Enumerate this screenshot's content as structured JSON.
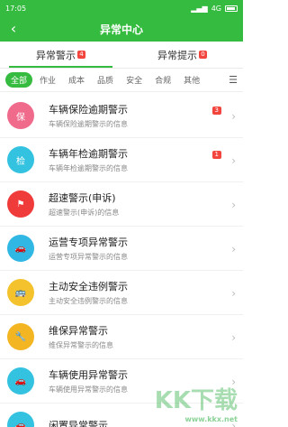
{
  "status": {
    "time": "17:05",
    "battery": "4G"
  },
  "header": {
    "title": "异常中心",
    "back_icon": "chevron-left-icon"
  },
  "tabs": [
    {
      "label": "异常警示",
      "badge": "4",
      "active": true
    },
    {
      "label": "异常提示",
      "badge": "0",
      "active": false
    }
  ],
  "filters": {
    "chips": [
      "全部",
      "作业",
      "成本",
      "品质",
      "安全",
      "合规",
      "其他"
    ],
    "active_index": 0,
    "menu_icon": "list-icon"
  },
  "items": [
    {
      "title": "车辆保险逾期警示",
      "sub": "车辆保险逾期警示的信息",
      "count": "3",
      "color": "#f06a8b",
      "icon": "shield-icon",
      "glyph": "保"
    },
    {
      "title": "车辆年检逾期警示",
      "sub": "车辆年检逾期警示的信息",
      "count": "1",
      "color": "#33c2df",
      "icon": "check-icon",
      "glyph": "检"
    },
    {
      "title": "超速警示(申诉)",
      "sub": "超速警示(申诉)的信息",
      "count": "",
      "color": "#f03b3b",
      "icon": "speed-icon",
      "glyph": "⚑"
    },
    {
      "title": "运营专项异常警示",
      "sub": "运营专项异常警示的信息",
      "count": "",
      "color": "#30b7e3",
      "icon": "car-icon",
      "glyph": "🚗"
    },
    {
      "title": "主动安全违例警示",
      "sub": "主动安全违例警示的信息",
      "count": "",
      "color": "#f4c22c",
      "icon": "bus-icon",
      "glyph": "🚌"
    },
    {
      "title": "维保异常警示",
      "sub": "维保异常警示的信息",
      "count": "",
      "color": "#f4b522",
      "icon": "wrench-icon",
      "glyph": "🔧"
    },
    {
      "title": "车辆使用异常警示",
      "sub": "车辆使用异常警示的信息",
      "count": "",
      "color": "#33c2df",
      "icon": "car-icon",
      "glyph": "🚗"
    },
    {
      "title": "闲置异常警示",
      "sub": "",
      "count": "",
      "color": "#33c2df",
      "icon": "car-icon",
      "glyph": "🚗"
    }
  ],
  "watermark": {
    "text": "KK下载",
    "url": "www.kkx.net"
  }
}
